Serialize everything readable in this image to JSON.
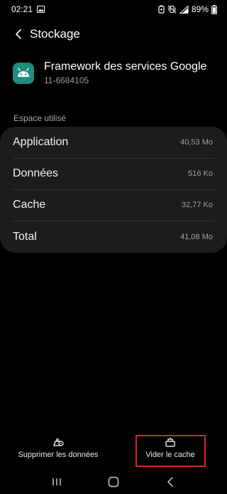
{
  "status_bar": {
    "time": "02:21",
    "battery": "89%",
    "icons": [
      "image-icon",
      "battery-saver-icon",
      "vibrate-mute-icon",
      "signal-icon",
      "battery-icon"
    ]
  },
  "header": {
    "title": "Stockage",
    "back_icon": "chevron-left-icon"
  },
  "app": {
    "name": "Framework des services Google",
    "version": "11-6684105",
    "icon": "android-icon",
    "icon_color": "#1e8e7e"
  },
  "storage": {
    "section_label": "Espace utilisé",
    "rows": [
      {
        "label": "Application",
        "value": "40,53 Mo"
      },
      {
        "label": "Données",
        "value": "516 Ko"
      },
      {
        "label": "Cache",
        "value": "32,77 Ko"
      },
      {
        "label": "Total",
        "value": "41,08 Mo"
      }
    ]
  },
  "actions": {
    "clear_data": "Supprimer les données",
    "clear_cache": "Vider le cache"
  },
  "colors": {
    "background": "#000000",
    "card": "#1c1c1c",
    "highlight": "#d8232a"
  }
}
